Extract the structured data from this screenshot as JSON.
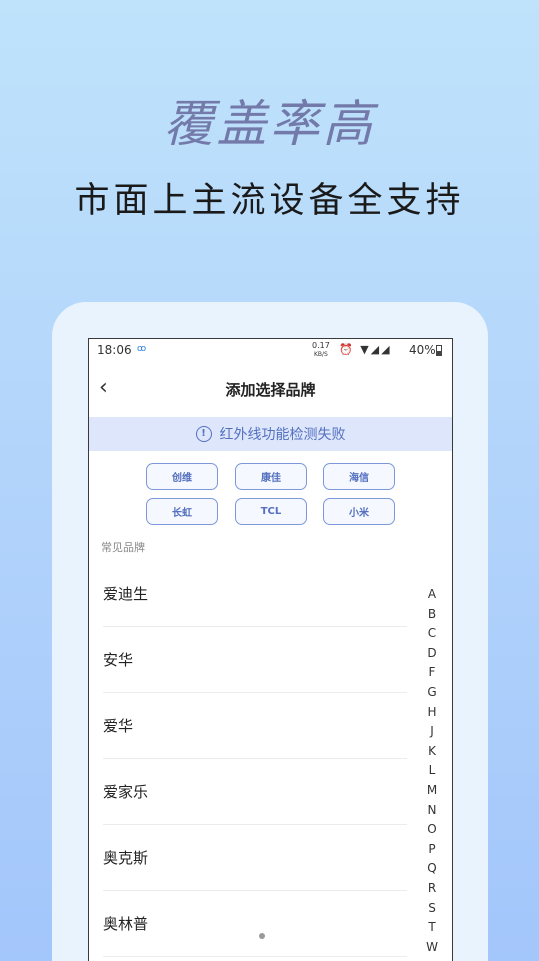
{
  "headline": "覆盖率高",
  "subheadline": "市面上主流设备全支持",
  "status_bar": {
    "time": "18:06",
    "app_glyph": "ꝏ",
    "net_speed_value": "0.17",
    "net_speed_unit": "KB/S",
    "icons_text": "⏰ ▼◢◢",
    "battery": "40%"
  },
  "nav": {
    "back_glyph": "‹",
    "title": "添加选择品牌"
  },
  "warning": {
    "icon_glyph": "!",
    "text": "红外线功能检测失败"
  },
  "quick_brands": [
    "创维",
    "康佳",
    "海信",
    "长虹",
    "TCL",
    "小米"
  ],
  "section_label": "常见品牌",
  "brands": [
    "爱迪生",
    "安华",
    "爱华",
    "爱家乐",
    "奥克斯",
    "奥林普"
  ],
  "alphabet": [
    "A",
    "B",
    "C",
    "D",
    "F",
    "G",
    "H",
    "J",
    "K",
    "L",
    "M",
    "N",
    "O",
    "P",
    "Q",
    "R",
    "S",
    "T",
    "W"
  ],
  "colors": {
    "accent": "#5470bf",
    "banner_bg": "#dde6fb",
    "headline": "#7379a8"
  }
}
